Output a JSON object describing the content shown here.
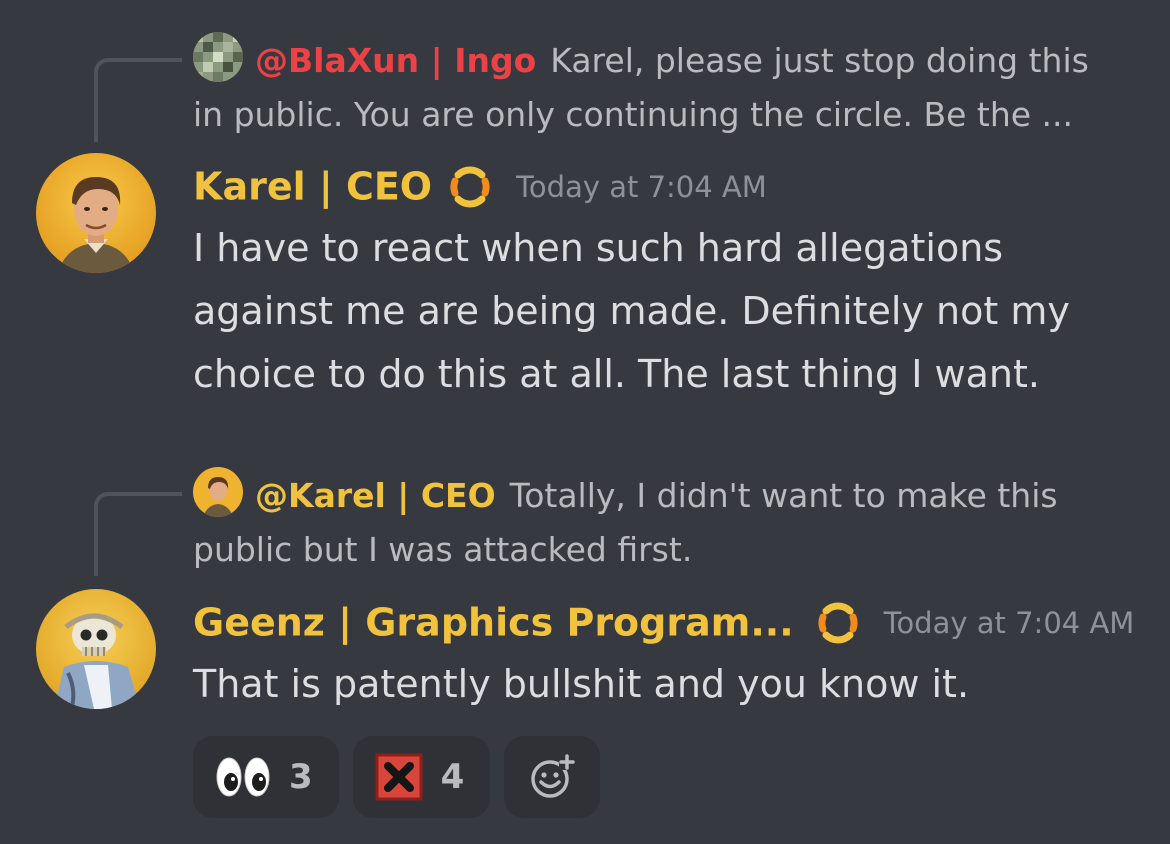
{
  "messages": [
    {
      "reply": {
        "author": "@BlaXun | Ingo",
        "author_color": "#ed4245",
        "line1": "Karel, please just stop doing this",
        "line2": "in public. You are only continuing the circle. Be the ..."
      },
      "author": "Karel | CEO",
      "author_color": "#f0c23e",
      "role_icon": "community-role-icon",
      "timestamp": "Today at 7:04 AM",
      "body": "I have to react when such hard allegations against me are being made. Definitely not my choice to do this at all. The last thing I want."
    },
    {
      "reply": {
        "author": "@Karel | CEO",
        "author_color": "#f0c23e",
        "line1": "Totally, I didn't want to make this",
        "line2": "public but I was attacked first."
      },
      "author": "Geenz | Graphics Program...",
      "author_color": "#f0c23e",
      "role_icon": "community-role-icon",
      "timestamp": "Today at 7:04 AM",
      "body": "That is patently bullshit and you know it.",
      "reactions": [
        {
          "emoji": "eyes-emoji",
          "count": "3"
        },
        {
          "emoji": "x-emoji",
          "count": "4"
        }
      ],
      "add_reaction_icon": "add-reaction-icon"
    }
  ]
}
